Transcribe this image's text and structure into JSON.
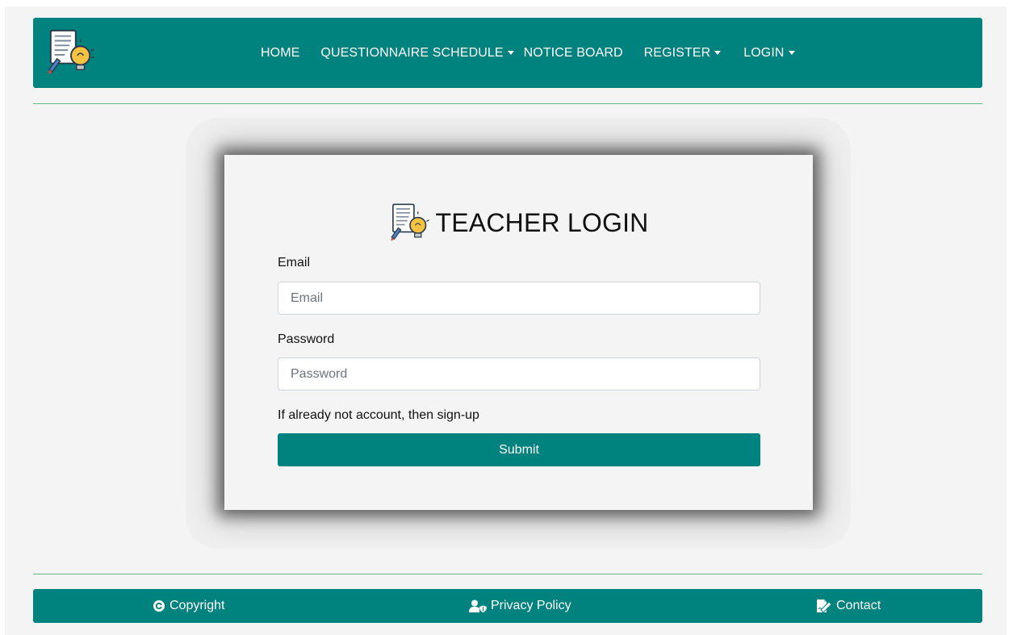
{
  "nav": {
    "items": [
      {
        "label": "HOME"
      },
      {
        "label": "QUESTIONNAIRE SCHEDULE"
      },
      {
        "label": "NOTICE BOARD"
      },
      {
        "label": "REGISTER"
      },
      {
        "label": "LOGIN"
      }
    ]
  },
  "login": {
    "title": "TEACHER LOGIN",
    "email_label": "Email",
    "email_placeholder": "Email",
    "email_value": "",
    "password_label": "Password",
    "password_placeholder": "Password",
    "password_value": "",
    "signup_hint": "If already not account, then sign-up",
    "submit_label": "Submit"
  },
  "footer": {
    "copyright": "Copyright",
    "privacy": "Privacy Policy",
    "contact": "Contact"
  },
  "colors": {
    "brand": "#00827f",
    "divider": "#66bb8c"
  }
}
